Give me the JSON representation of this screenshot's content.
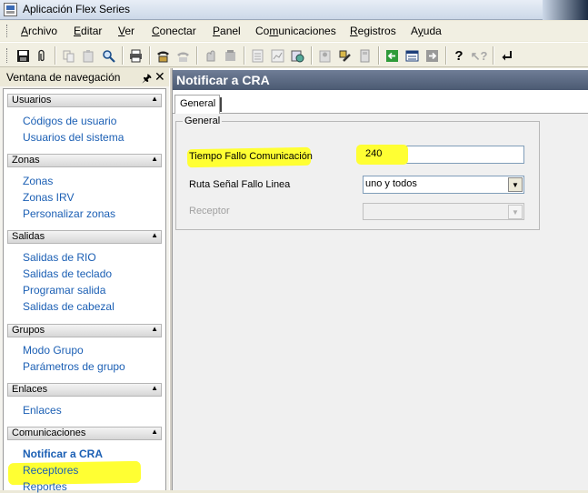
{
  "window": {
    "title": "Aplicación Flex Series"
  },
  "menu": [
    {
      "pre": "",
      "u": "A",
      "post": "rchivo"
    },
    {
      "pre": "",
      "u": "E",
      "post": "ditar"
    },
    {
      "pre": "",
      "u": "V",
      "post": "er"
    },
    {
      "pre": "",
      "u": "C",
      "post": "onectar"
    },
    {
      "pre": "",
      "u": "P",
      "post": "anel"
    },
    {
      "pre": "Co",
      "u": "m",
      "post": "unicaciones"
    },
    {
      "pre": "",
      "u": "R",
      "post": "egistros"
    },
    {
      "pre": "A",
      "u": "y",
      "post": "uda"
    }
  ],
  "toolbar": {
    "icons": [
      "save-icon",
      "attach-icon",
      "copy-icon",
      "paste-icon",
      "find-icon",
      "print-icon",
      "phone-connect-icon",
      "phone-disconnect-icon",
      "panel-arm-icon",
      "panel-sound-icon",
      "report-icon",
      "chart-icon",
      "event-log-icon",
      "user-icon",
      "tools-icon",
      "calculator-icon",
      "back-arrow-icon",
      "list-icon",
      "forward-arrow-icon",
      "help-icon",
      "help-context-icon",
      "return-icon"
    ]
  },
  "nav": {
    "title": "Ventana de navegación",
    "pin_glyph": "🖈",
    "close_glyph": "✕",
    "groups": [
      {
        "name": "Usuarios",
        "items": [
          "Códigos de usuario",
          "Usuarios del sistema"
        ]
      },
      {
        "name": "Zonas",
        "items": [
          "Zonas",
          "Zonas IRV",
          "Personalizar zonas"
        ]
      },
      {
        "name": "Salidas",
        "items": [
          "Salidas de RIO",
          "Salidas de teclado",
          "Programar salida",
          "Salidas de cabezal"
        ]
      },
      {
        "name": "Grupos",
        "items": [
          "Modo Grupo",
          "Parámetros de grupo"
        ]
      },
      {
        "name": "Enlaces",
        "items": [
          "Enlaces"
        ]
      },
      {
        "name": "Comunicaciones",
        "items": [
          "Notificar a CRA",
          "Receptores",
          "Reportes"
        ]
      }
    ],
    "selected": "Notificar a CRA"
  },
  "main": {
    "title": "Notificar a CRA",
    "tab": "General",
    "group_title": "General",
    "fields": {
      "tiempo_label": "Tiempo Fallo Comunicación",
      "tiempo_value": "240",
      "ruta_label": "Ruta Señal Fallo Linea",
      "ruta_value": "uno y todos",
      "receptor_label": "Receptor",
      "receptor_value": ""
    }
  },
  "colors": {
    "highlight": "#ffff33",
    "link": "#1b5fb4",
    "header": "#5a6880"
  }
}
